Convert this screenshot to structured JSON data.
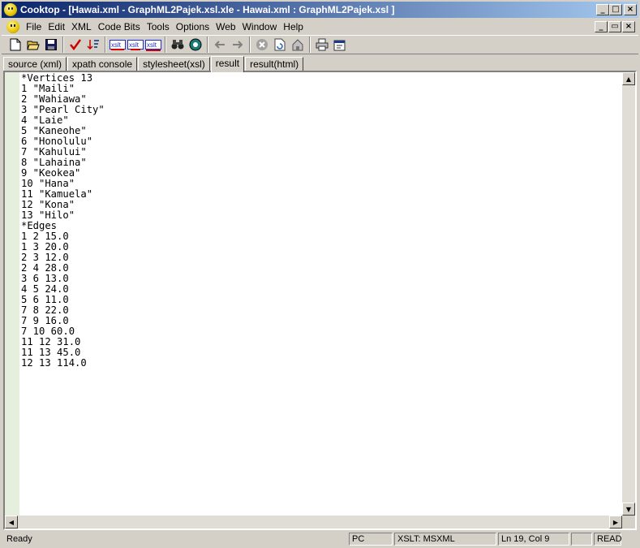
{
  "window": {
    "title": "Cooktop - [Hawai.xml - GraphML2Pajek.xsl.xle - Hawai.xml : GraphML2Pajek.xsl ]",
    "minimize": "_",
    "maximize": "□",
    "close": "×",
    "restore": "▭"
  },
  "menu": {
    "items": [
      "File",
      "Edit",
      "XML",
      "Code Bits",
      "Tools",
      "Options",
      "Web",
      "Window",
      "Help"
    ]
  },
  "toolbar": {
    "icons": [
      "new-file-icon",
      "open-folder-icon",
      "save-icon",
      "check-icon",
      "sort-icon",
      "xslt-icon-1",
      "xslt-icon-2",
      "xslt-icon-3",
      "binoculars-icon",
      "globe-icon",
      "back-arrow-icon",
      "forward-arrow-icon",
      "stop-icon",
      "refresh-icon",
      "home-icon",
      "print-icon",
      "properties-icon"
    ]
  },
  "tabs": [
    "source (xml)",
    "xpath console",
    "stylesheet(xsl)",
    "result",
    "result(html)"
  ],
  "active_tab": "result",
  "editor": {
    "lines": [
      "*Vertices 13",
      "1 \"Maili\"",
      "2 \"Wahiawa\"",
      "3 \"Pearl City\"",
      "4 \"Laie\"",
      "5 \"Kaneohe\"",
      "6 \"Honolulu\"",
      "7 \"Kahului\"",
      "8 \"Lahaina\"",
      "9 \"Keokea\"",
      "10 \"Hana\"",
      "11 \"Kamuela\"",
      "12 \"Kona\"",
      "13 \"Hilo\"",
      "*Edges",
      "1 2 15.0",
      "1 3 20.0",
      "2 3 12.0",
      "2 4 28.0",
      "3 6 13.0",
      "4 5 24.0",
      "5 6 11.0",
      "7 8 22.0",
      "7 9 16.0",
      "7 10 60.0",
      "11 12 31.0",
      "11 13 45.0",
      "12 13 114.0"
    ]
  },
  "status": {
    "ready": "Ready",
    "mode": "PC",
    "engine": "XSLT: MSXML",
    "position": "Ln 19, Col 9",
    "blank": "",
    "read": "READ"
  }
}
